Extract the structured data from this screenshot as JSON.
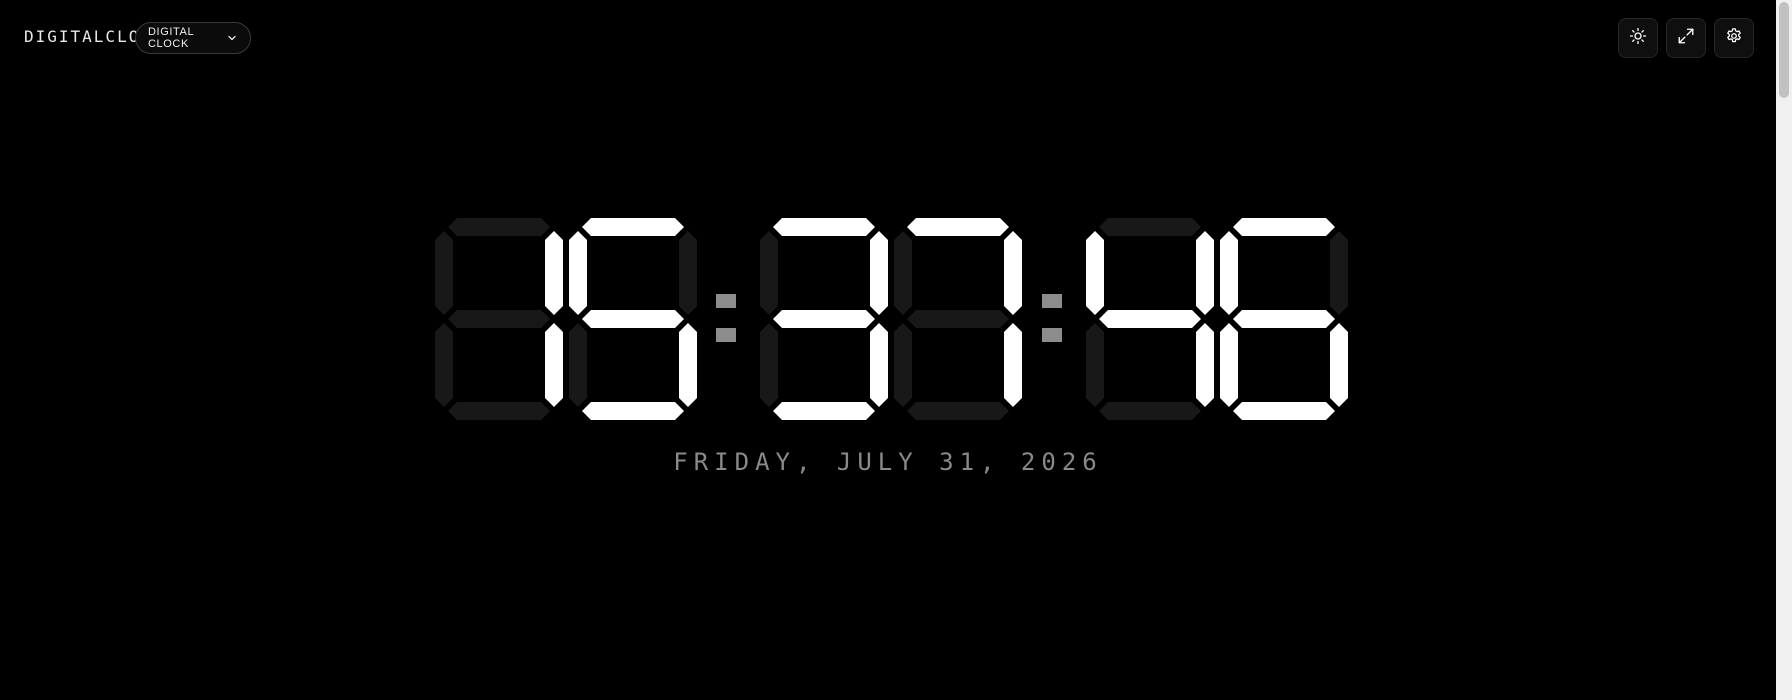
{
  "header": {
    "brand": "DIGITALCLOCK",
    "mode_label": "DIGITAL CLOCK"
  },
  "toolbar": {
    "theme_icon": "sun-icon",
    "fullscreen_icon": "expand-icon",
    "settings_icon": "gear-icon"
  },
  "clock": {
    "digits": [
      "1",
      "5",
      "3",
      "7",
      "4",
      "6"
    ],
    "separator": ":",
    "date": "FRIDAY, JULY 31, 2026"
  },
  "colors": {
    "background": "#000000",
    "segment_on": "#ffffff",
    "segment_off": "#181818",
    "colon": "#8c8c8c",
    "date_text": "#8a8a8a"
  }
}
